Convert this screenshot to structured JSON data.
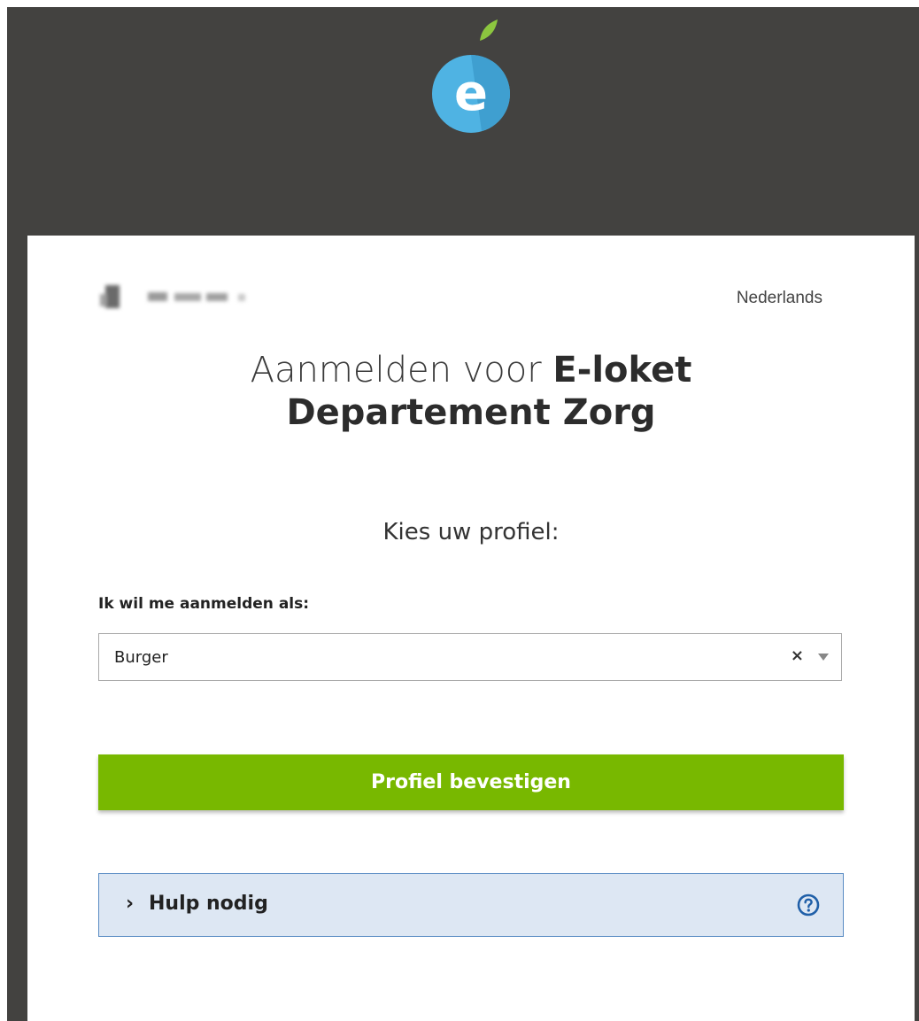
{
  "header": {
    "logo_icon": "e-loket-apple-logo-icon",
    "logo_letter": "e"
  },
  "user": {
    "display_name": "",
    "avatar_icon": "user-avatar-icon"
  },
  "language": {
    "selected": "Nederlands"
  },
  "login": {
    "title_prefix": "Aanmelden voor ",
    "title_app_line1": "E-loket",
    "title_app_line2": "Departement Zorg",
    "prompt": "Kies uw profiel:",
    "role_label": "Ik wil me aanmelden als:",
    "role_value": "Burger",
    "clear_symbol": "×",
    "confirm_button": "Profiel bevestigen"
  },
  "help": {
    "chevron": "›",
    "label": "Hulp nodig",
    "icon": "question-circle-icon"
  },
  "colors": {
    "header_bg": "#434240",
    "confirm_green": "#78b800",
    "help_bg": "#dde7f3",
    "help_border": "#5a8cc4",
    "logo_blue": "#4fb3e3",
    "leaf_green": "#8cc63f"
  }
}
